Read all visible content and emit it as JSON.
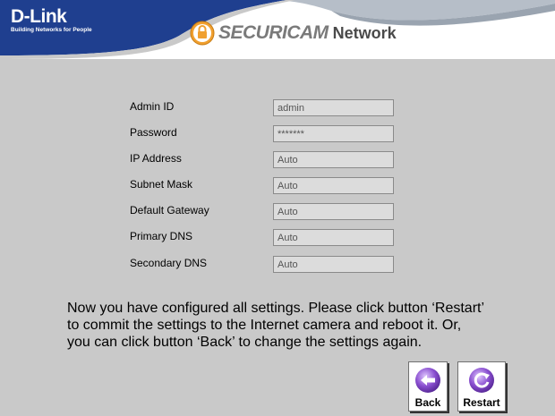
{
  "header": {
    "logo_text": "D-Link",
    "tagline": "Building Networks for People",
    "brand_securicam": "SECURICAM",
    "brand_network": "Network"
  },
  "form": {
    "fields": [
      {
        "label": "Admin ID",
        "value": "admin"
      },
      {
        "label": "Password",
        "value": "*******"
      },
      {
        "label": "IP Address",
        "value": "Auto"
      },
      {
        "label": "Subnet Mask",
        "value": "Auto"
      },
      {
        "label": "Default Gateway",
        "value": "Auto"
      },
      {
        "label": "Primary DNS",
        "value": "Auto"
      },
      {
        "label": "Secondary DNS",
        "value": "Auto"
      }
    ]
  },
  "message": "Now you have configured all settings. Please click button ‘Restart’ to commit the settings to the Internet camera and reboot it. Or, you can click button ‘Back’ to change the settings again.",
  "buttons": {
    "back_label": "Back",
    "restart_label": "Restart"
  },
  "colors": {
    "header_blue": "#1f3f8f",
    "swoosh_gray": "#a9b3bf",
    "background": "#c9c9c9",
    "icon_purple": "#7a3fc0"
  },
  "icons": {
    "brand": "lock-icon",
    "back": "back-arrow-icon",
    "restart": "restart-icon"
  }
}
